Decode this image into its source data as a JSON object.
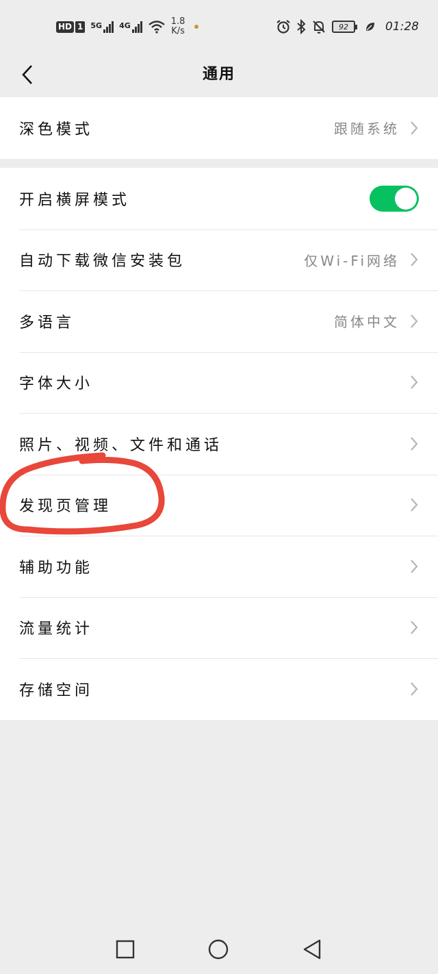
{
  "status_bar": {
    "hd": "HD",
    "sim": "1",
    "net1": "5G",
    "net2": "4G",
    "speed_value": "1.8",
    "speed_unit": "K/s",
    "battery": "92",
    "time": "01:28"
  },
  "header": {
    "title": "通用"
  },
  "groups": {
    "display": {
      "dark_mode": {
        "label": "深色模式",
        "value": "跟随系统"
      }
    },
    "general": {
      "landscape": {
        "label": "开启横屏模式",
        "enabled": true
      },
      "auto_download": {
        "label": "自动下载微信安装包",
        "value": "仅Wi-Fi网络"
      },
      "language": {
        "label": "多语言",
        "value": "简体中文"
      },
      "font_size": {
        "label": "字体大小"
      },
      "media": {
        "label": "照片、视频、文件和通话"
      },
      "discover": {
        "label": "发现页管理"
      },
      "accessibility": {
        "label": "辅助功能"
      },
      "traffic": {
        "label": "流量统计"
      },
      "storage": {
        "label": "存储空间"
      }
    }
  },
  "colors": {
    "accent": "#07c160",
    "annotation": "#e8473a"
  }
}
